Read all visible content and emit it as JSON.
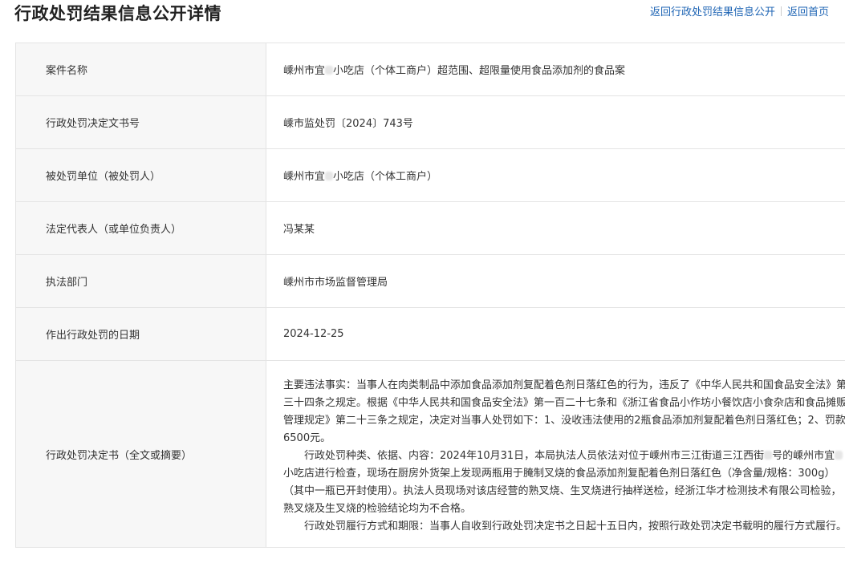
{
  "header": {
    "title": "行政处罚结果信息公开详情",
    "nav": {
      "back_list": "返回行政处罚结果信息公开",
      "back_home": "返回首页"
    }
  },
  "rows": [
    {
      "label": "案件名称",
      "value_pre": "嵊州市宜",
      "value_post": "小吃店（个体工商户）超范围、超限量使用食品添加剂的食品案"
    },
    {
      "label": "行政处罚决定文书号",
      "value": "嵊市监处罚〔2024〕743号"
    },
    {
      "label": "被处罚单位（被处罚人）",
      "value_pre": "嵊州市宜",
      "value_post": "小吃店（个体工商户）"
    },
    {
      "label": "法定代表人（或单位负责人）",
      "value": "冯某某"
    },
    {
      "label": "执法部门",
      "value": "嵊州市市场监督管理局"
    },
    {
      "label": "作出行政处罚的日期",
      "value": "2024-12-25"
    }
  ],
  "decision": {
    "label": "行政处罚决定书（全文或摘要）",
    "para1": "主要违法事实：当事人在肉类制品中添加食品添加剂复配着色剂日落红色的行为，违反了《中华人民共和国食品安全法》第三十四条之规定。根据《中华人民共和国食品安全法》第一百二十七条和《浙江省食品小作坊小餐饮店小食杂店和食品摊贩管理规定》第二十三条之规定，决定对当事人处罚如下：1、没收违法使用的2瓶食品添加剂复配着色剂日落红色；2、罚款6500元。",
    "para2_a": "行政处罚种类、依据、内容：2024年10月31日，本局执法人员依法对位于嵊州市三江街道三江西街",
    "para2_b": "号的嵊州市宜",
    "para2_c": "小吃店进行检查，现场在厨房外货架上发现两瓶用于腌制叉烧的食品添加剂复配着色剂日落红色（净含量/规格：300g）（其中一瓶已开封使用）。执法人员现场对该店经营的熟叉烧、生叉烧进行抽样送检，经浙江华才检测技术有限公司检验，熟叉烧及生叉烧的检验结论均为不合格。",
    "para3": "行政处罚履行方式和期限：当事人自收到行政处罚决定书之日起十五日内，按照行政处罚决定书载明的履行方式履行。"
  }
}
